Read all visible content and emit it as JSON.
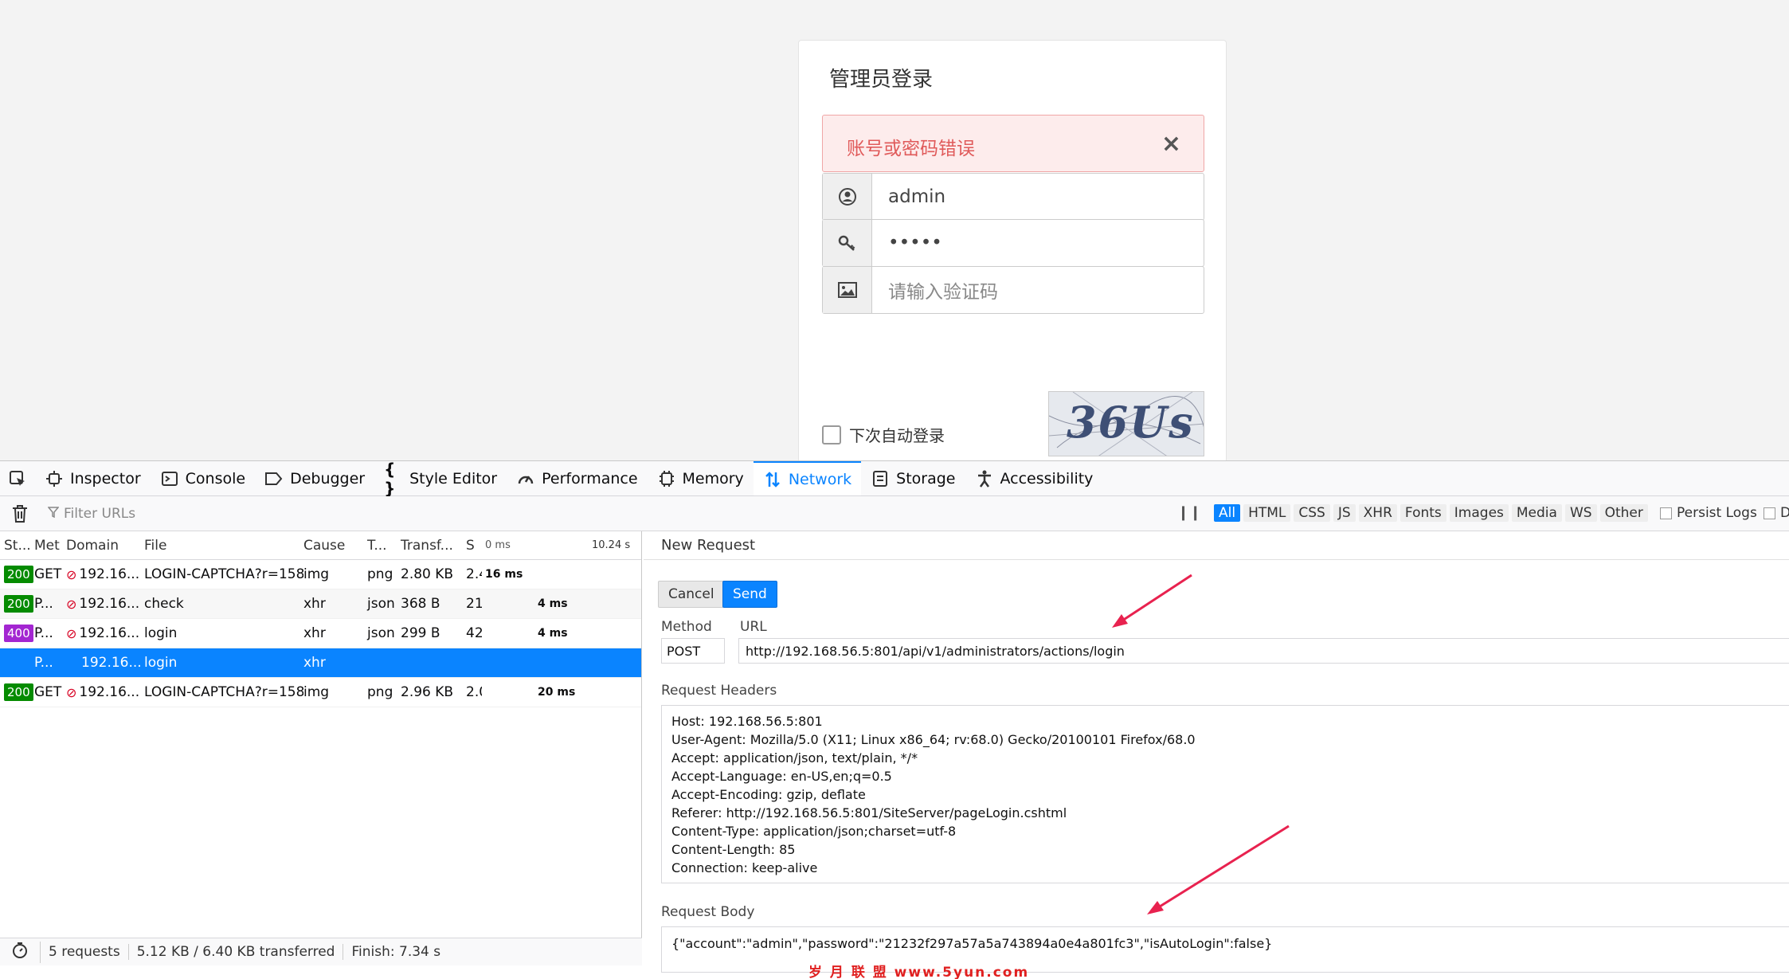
{
  "login": {
    "title": "管理员登录",
    "error_message": "账号或密码错误",
    "close_symbol": "×",
    "username_value": "admin",
    "password_value": "•••••",
    "captcha_placeholder": "请输入验证码",
    "remember_label": "下次自动登录",
    "captcha_image_text": "36Us"
  },
  "devtools": {
    "tabs": [
      {
        "label": "Inspector",
        "icon": "inspector-icon"
      },
      {
        "label": "Console",
        "icon": "console-icon"
      },
      {
        "label": "Debugger",
        "icon": "debugger-icon"
      },
      {
        "label": "Style Editor",
        "icon": "style-editor-icon"
      },
      {
        "label": "Performance",
        "icon": "performance-icon"
      },
      {
        "label": "Memory",
        "icon": "memory-icon"
      },
      {
        "label": "Network",
        "icon": "network-icon",
        "selected": true
      },
      {
        "label": "Storage",
        "icon": "storage-icon"
      },
      {
        "label": "Accessibility",
        "icon": "accessibility-icon"
      }
    ],
    "filter_placeholder": "Filter URLs",
    "type_filters": [
      "All",
      "HTML",
      "CSS",
      "JS",
      "XHR",
      "Fonts",
      "Images",
      "Media",
      "WS",
      "Other"
    ],
    "active_type_filter": "All",
    "persist_logs_label": "Persist Logs",
    "disable_cache_label": "D",
    "columns": {
      "status": "St...",
      "method": "Met",
      "domain": "Domain",
      "file": "File",
      "cause": "Cause",
      "type": "T...",
      "transferred": "Transf...",
      "size": "S",
      "waterfall_start": "0 ms",
      "waterfall_end": "10.24 s"
    },
    "requests": [
      {
        "status": "200",
        "method": "GET",
        "domain": "192.16...",
        "file": "LOGIN-CAPTCHA?r=158...",
        "cause": "img",
        "type": "png",
        "transferred": "2.80 KB",
        "size": "2.4",
        "timing": "16 ms"
      },
      {
        "status": "200",
        "method": "P...",
        "domain": "192.16...",
        "file": "check",
        "cause": "xhr",
        "type": "json",
        "transferred": "368 B",
        "size": "21",
        "timing": "4 ms"
      },
      {
        "status": "400",
        "method": "P...",
        "domain": "192.16...",
        "file": "login",
        "cause": "xhr",
        "type": "json",
        "transferred": "299 B",
        "size": "42",
        "timing": "4 ms"
      },
      {
        "status": "",
        "method": "P...",
        "domain": "192.16...",
        "file": "login",
        "cause": "xhr",
        "type": "",
        "transferred": "",
        "size": "",
        "timing": "",
        "selected": true
      },
      {
        "status": "200",
        "method": "GET",
        "domain": "192.16...",
        "file": "LOGIN-CAPTCHA?r=158...",
        "cause": "img",
        "type": "png",
        "transferred": "2.96 KB",
        "size": "2.0",
        "timing": "20 ms"
      }
    ],
    "summary": {
      "requests": "5 requests",
      "transferred": "5.12 KB / 6.40 KB transferred",
      "finish": "Finish: 7.34 s"
    },
    "new_request": {
      "title": "New Request",
      "cancel_label": "Cancel",
      "send_label": "Send",
      "method_label": "Method",
      "url_label": "URL",
      "method_value": "POST",
      "url_value": "http://192.168.56.5:801/api/v1/administrators/actions/login",
      "headers_label": "Request Headers",
      "headers_value": "Host: 192.168.56.5:801\nUser-Agent: Mozilla/5.0 (X11; Linux x86_64; rv:68.0) Gecko/20100101 Firefox/68.0\nAccept: application/json, text/plain, */*\nAccept-Language: en-US,en;q=0.5\nAccept-Encoding: gzip, deflate\nReferer: http://192.168.56.5:801/SiteServer/pageLogin.cshtml\nContent-Type: application/json;charset=utf-8\nContent-Length: 85\nConnection: keep-alive",
      "body_label": "Request Body",
      "body_value": "{\"account\":\"admin\",\"password\":\"21232f297a57a5a743894a0e4a801fc3\",\"isAutoLogin\":false}"
    }
  },
  "watermark": "岁 月 联 盟   www.5yun.com",
  "colors": {
    "accent": "#0a84ff",
    "status_ok": "#058b00",
    "status_error": "#a326d1",
    "alert_text": "#e05a5a",
    "arrow": "#e8224f"
  }
}
